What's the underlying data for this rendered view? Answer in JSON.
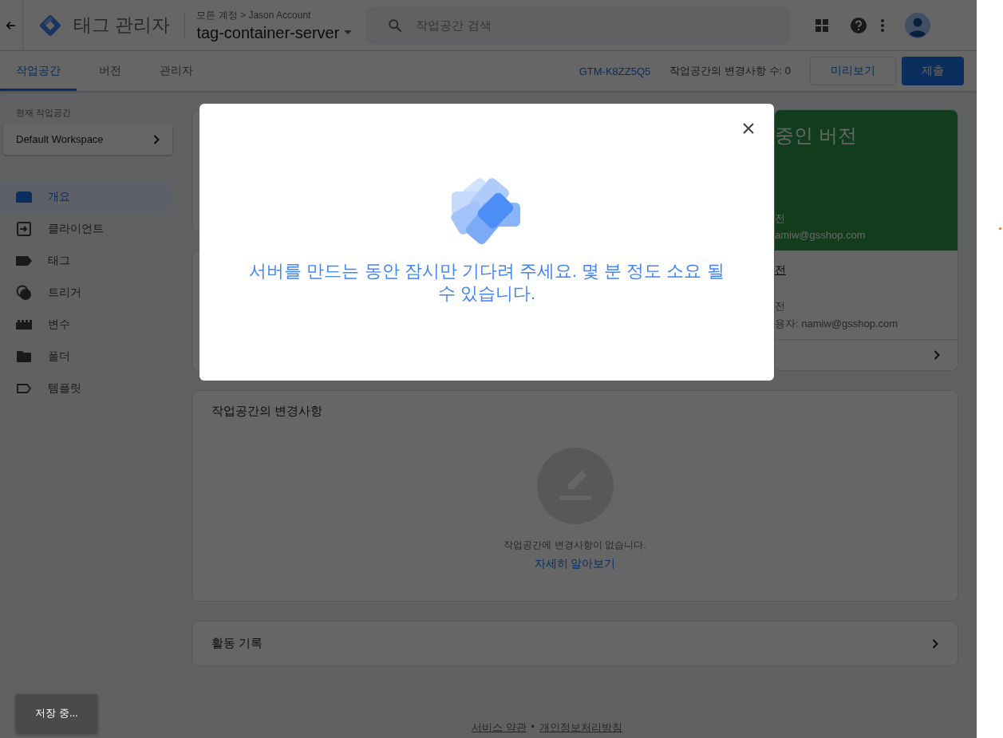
{
  "header": {
    "product": "태그 관리자",
    "breadcrumb": "모든 계정 > Jason Account",
    "container": "tag-container-server",
    "search": {
      "placeholder": "작업공간 검색"
    }
  },
  "tabs": [
    {
      "label": "작업공간",
      "selected": true
    },
    {
      "label": "버전",
      "selected": false
    },
    {
      "label": "관리자",
      "selected": false
    }
  ],
  "toolbar": {
    "container_id": "GTM-K8ZZ5Q5",
    "changes": "작업공간의 변경사항 수: 0",
    "buttons": [
      {
        "label": "미리보기",
        "kind": "outlined"
      },
      {
        "label": "제출",
        "kind": "primary"
      }
    ]
  },
  "sidebar": {
    "workspace_label": "현재 작업공간",
    "workspace": "Default Workspace",
    "items": [
      {
        "label": "개요",
        "selected": true
      },
      {
        "label": "클라이언트",
        "selected": false
      },
      {
        "label": "태그",
        "selected": false
      },
      {
        "label": "트리거",
        "selected": false
      },
      {
        "label": "변수",
        "selected": false
      },
      {
        "label": "폴더",
        "selected": false
      },
      {
        "label": "템플릿",
        "selected": false
      }
    ]
  },
  "published_card": {
    "title": "중인 버전",
    "lines": [
      "전",
      "amiw@gsshop.com"
    ],
    "latest_title": "전",
    "latest_lines": [
      "전",
      "용자: namiw@gsshop.com"
    ]
  },
  "changes_card": {
    "title": "작업공간의 변경사항",
    "empty_text": "작업공간에 변경사항이 없습니다.",
    "link": "자세히 알아보기"
  },
  "activity_card": {
    "title": "활동 기록"
  },
  "footer": {
    "links": [
      "서비스 약관",
      "개인정보처리방침"
    ],
    "separator": "•"
  },
  "toast": "저장 중...",
  "modal": {
    "message": "서버를 만드는 동안 잠시만 기다려 주세요. 몇 분 정도 소요 될 수 있습니다."
  }
}
